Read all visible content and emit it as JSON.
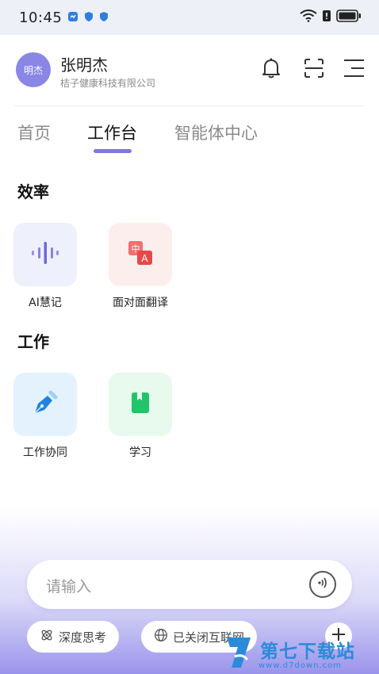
{
  "status_bar": {
    "time": "10:45",
    "battery_icon": "battery-icon",
    "wifi_icon": "wifi-icon"
  },
  "header": {
    "avatar_text": "明杰",
    "user_name": "张明杰",
    "org_name": "桔子健康科技有限公司"
  },
  "tabs": [
    {
      "label": "首页",
      "active": false
    },
    {
      "label": "工作台",
      "active": true
    },
    {
      "label": "智能体中心",
      "active": false
    }
  ],
  "sections": [
    {
      "title": "效率",
      "items": [
        {
          "label": "AI慧记",
          "icon": "voice-wave-icon"
        },
        {
          "label": "面对面翻译",
          "icon": "translate-icon"
        }
      ]
    },
    {
      "title": "工作",
      "items": [
        {
          "label": "工作协同",
          "icon": "pen-icon"
        },
        {
          "label": "学习",
          "icon": "book-icon"
        }
      ]
    }
  ],
  "composer": {
    "placeholder": "请输入",
    "chips": [
      {
        "label": "深度思考",
        "icon": "atom-icon"
      },
      {
        "label": "已关闭互联网",
        "icon": "globe-icon"
      }
    ]
  },
  "watermark": {
    "title": "第七下载站",
    "url": "www.d7down.com"
  },
  "colors": {
    "accent": "#7c77e8",
    "avatar": "#8a86e6"
  }
}
